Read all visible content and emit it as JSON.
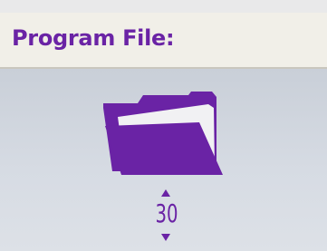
{
  "colors": {
    "accent": "#6a23a5",
    "header_bg": "#f1efe8",
    "screen_bg": "#d3d8e0"
  },
  "header": {
    "title": "Program File:"
  },
  "main": {
    "icon": "folder-icon",
    "selector": {
      "value": "30",
      "up_icon": "arrow-up-icon",
      "down_icon": "arrow-down-icon"
    }
  }
}
